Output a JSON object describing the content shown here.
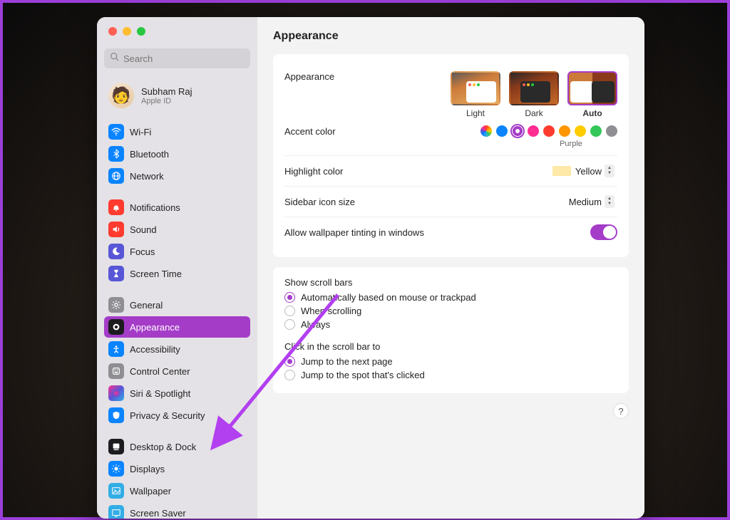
{
  "window": {
    "title": "Appearance",
    "search_placeholder": "Search"
  },
  "user": {
    "name": "Subham Raj",
    "sub": "Apple ID"
  },
  "sidebar": {
    "group1": [
      {
        "icon": "wifi",
        "bg": "#0a84ff",
        "label": "Wi-Fi"
      },
      {
        "icon": "bt",
        "bg": "#0a84ff",
        "label": "Bluetooth"
      },
      {
        "icon": "net",
        "bg": "#0a84ff",
        "label": "Network"
      }
    ],
    "group2": [
      {
        "icon": "bell",
        "bg": "#ff3b30",
        "label": "Notifications"
      },
      {
        "icon": "sound",
        "bg": "#ff3b30",
        "label": "Sound"
      },
      {
        "icon": "moon",
        "bg": "#5856d6",
        "label": "Focus"
      },
      {
        "icon": "hour",
        "bg": "#5856d6",
        "label": "Screen Time"
      }
    ],
    "group3": [
      {
        "icon": "gear",
        "bg": "#8e8e93",
        "label": "General"
      },
      {
        "icon": "app",
        "bg": "#1c1c1e",
        "label": "Appearance",
        "active": true
      },
      {
        "icon": "acc",
        "bg": "#0a84ff",
        "label": "Accessibility"
      },
      {
        "icon": "cc",
        "bg": "#8e8e93",
        "label": "Control Center"
      },
      {
        "icon": "siri",
        "bg": "grad",
        "label": "Siri & Spotlight"
      },
      {
        "icon": "priv",
        "bg": "#0a84ff",
        "label": "Privacy & Security"
      }
    ],
    "group4": [
      {
        "icon": "dock",
        "bg": "#1c1c1e",
        "label": "Desktop & Dock"
      },
      {
        "icon": "disp",
        "bg": "#0a84ff",
        "label": "Displays"
      },
      {
        "icon": "wall",
        "bg": "#32ade6",
        "label": "Wallpaper"
      },
      {
        "icon": "ss",
        "bg": "#32ade6",
        "label": "Screen Saver"
      }
    ]
  },
  "appearance": {
    "label": "Appearance",
    "options": [
      {
        "key": "light",
        "label": "Light"
      },
      {
        "key": "dark",
        "label": "Dark"
      },
      {
        "key": "auto",
        "label": "Auto",
        "selected": true
      }
    ]
  },
  "accent": {
    "label": "Accent color",
    "selected_name": "Purple",
    "colors": [
      {
        "name": "multicolor",
        "hex": "conic"
      },
      {
        "name": "blue",
        "hex": "#0a84ff"
      },
      {
        "name": "purple",
        "hex": "#a43cc8",
        "selected": true
      },
      {
        "name": "pink",
        "hex": "#ff2d92"
      },
      {
        "name": "red",
        "hex": "#ff3b30"
      },
      {
        "name": "orange",
        "hex": "#ff9500"
      },
      {
        "name": "yellow",
        "hex": "#ffcc00"
      },
      {
        "name": "green",
        "hex": "#34c759"
      },
      {
        "name": "gray",
        "hex": "#8e8e93"
      }
    ]
  },
  "highlight": {
    "label": "Highlight color",
    "value": "Yellow",
    "swatch": "#ffe9a8"
  },
  "sidebar_size": {
    "label": "Sidebar icon size",
    "value": "Medium"
  },
  "tinting": {
    "label": "Allow wallpaper tinting in windows",
    "on": true
  },
  "scrollbars": {
    "title": "Show scroll bars",
    "options": [
      {
        "label": "Automatically based on mouse or trackpad",
        "checked": true
      },
      {
        "label": "When scrolling",
        "checked": false
      },
      {
        "label": "Always",
        "checked": false
      }
    ]
  },
  "click_scroll": {
    "title": "Click in the scroll bar to",
    "options": [
      {
        "label": "Jump to the next page",
        "checked": true
      },
      {
        "label": "Jump to the spot that's clicked",
        "checked": false
      }
    ]
  },
  "help": "?"
}
